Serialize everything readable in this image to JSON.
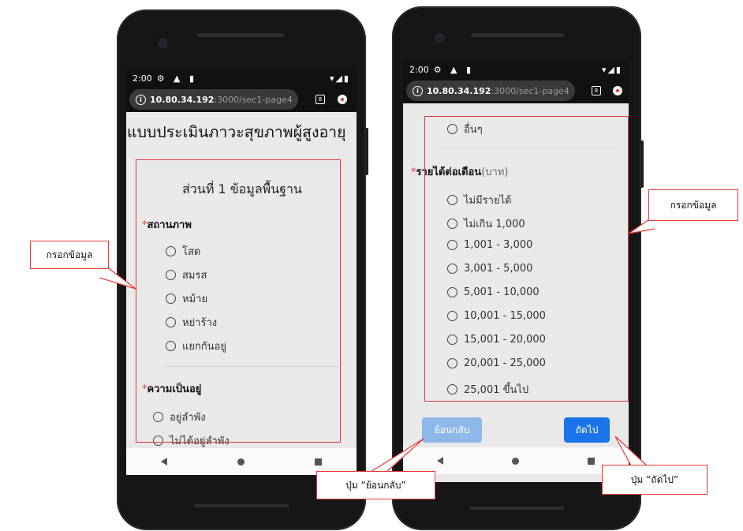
{
  "left_phone": {
    "status": {
      "time": "2:00",
      "icons": "⚙ ▲ ▮",
      "right": "▾◢▮"
    },
    "url": {
      "host": "10.80.34.192",
      "path": ":3000/sec1-page4"
    },
    "page_heading": "แบบประเมินภาวะสุขภาพผู้สูงอายุ",
    "section_title": "ส่วนที่ 1 ข้อมูลพื้นฐาน",
    "q_marital": {
      "required_mark": "*",
      "label": "สถานภาพ",
      "options": [
        "โสด",
        "สมรส",
        "หม้าย",
        "หย่าร้าง",
        "แยกกันอยู่"
      ]
    },
    "q_living": {
      "required_mark": "*",
      "label": "ความเป็นอยู่",
      "options": [
        "อยู่ลำพัง",
        "ไม่ได้อยู่ลำพัง"
      ]
    }
  },
  "right_phone": {
    "status": {
      "time": "2:00",
      "icons": "⚙ ▲ ▮",
      "right": "▾◢▮"
    },
    "url": {
      "host": "10.80.34.192",
      "path": ":3000/sec1-page4"
    },
    "prev_option": "อื่นๆ",
    "q_income": {
      "required_mark": "*",
      "label": "รายได้ต่อเดือน",
      "unit": "(บาท)",
      "options": [
        "ไม่มีรายได้",
        "ไม่เกิน 1,000",
        "1,001 - 3,000",
        "3,001 - 5,000",
        "5,001 - 10,000",
        "10,001 - 15,000",
        "15,001 - 20,000",
        "20,001 - 25,000",
        "25,001 ขึ้นไป"
      ]
    },
    "back_button": "ย้อนกลับ",
    "next_button": "ถัดไป"
  },
  "annotations": {
    "fill_left": "กรอกข้อมูล",
    "fill_right": "กรอกข้อมูล",
    "back_note": "ปุ่ม “ย้อนกลับ”",
    "next_note": "ปุ่ม “ถัดไป”"
  },
  "colors": {
    "annotation_red": "#e53935",
    "primary_button": "#1a73e8",
    "disabled_button": "#8fb8ea"
  }
}
